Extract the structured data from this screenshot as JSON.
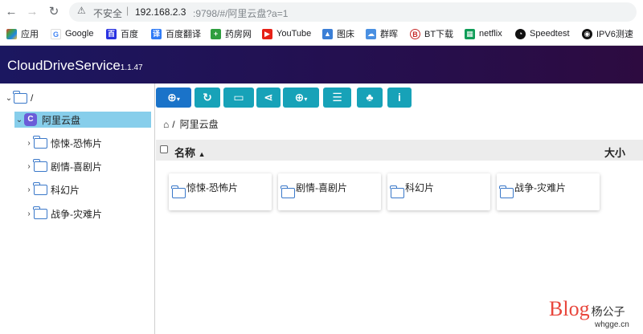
{
  "browser": {
    "insecure_label": "不安全",
    "address_host": "192.168.2.3",
    "address_path": ":9798/#/阿里云盘?a=1",
    "bookmarks": [
      "应用",
      "Google",
      "百度",
      "百度翻译",
      "药房网",
      "YouTube",
      "图床",
      "群晖",
      "BT下载",
      "netflix",
      "Speedtest",
      "IPV6测速"
    ]
  },
  "app": {
    "title": "CloudDriveService",
    "version": "1.1.47"
  },
  "tree": {
    "root": "/",
    "drive": "阿里云盘",
    "folders": [
      "惊悚-恐怖片",
      "剧情-喜剧片",
      "科幻片",
      "战争-灾难片"
    ]
  },
  "breadcrumb": {
    "root": "/",
    "current": "阿里云盘"
  },
  "list": {
    "col_name": "名称",
    "col_size": "大小",
    "items": [
      "惊悚-恐怖片",
      "剧情-喜剧片",
      "科幻片",
      "战争-灾难片"
    ]
  },
  "watermark": {
    "brand": "Blog",
    "name": "杨公子",
    "site": "whgge.cn"
  },
  "colors": {
    "toolbar_teal": "#17a2b8",
    "toolbar_primary": "#1a73c9",
    "selected_row": "#87ceeb",
    "app_header": "#1b1760"
  }
}
